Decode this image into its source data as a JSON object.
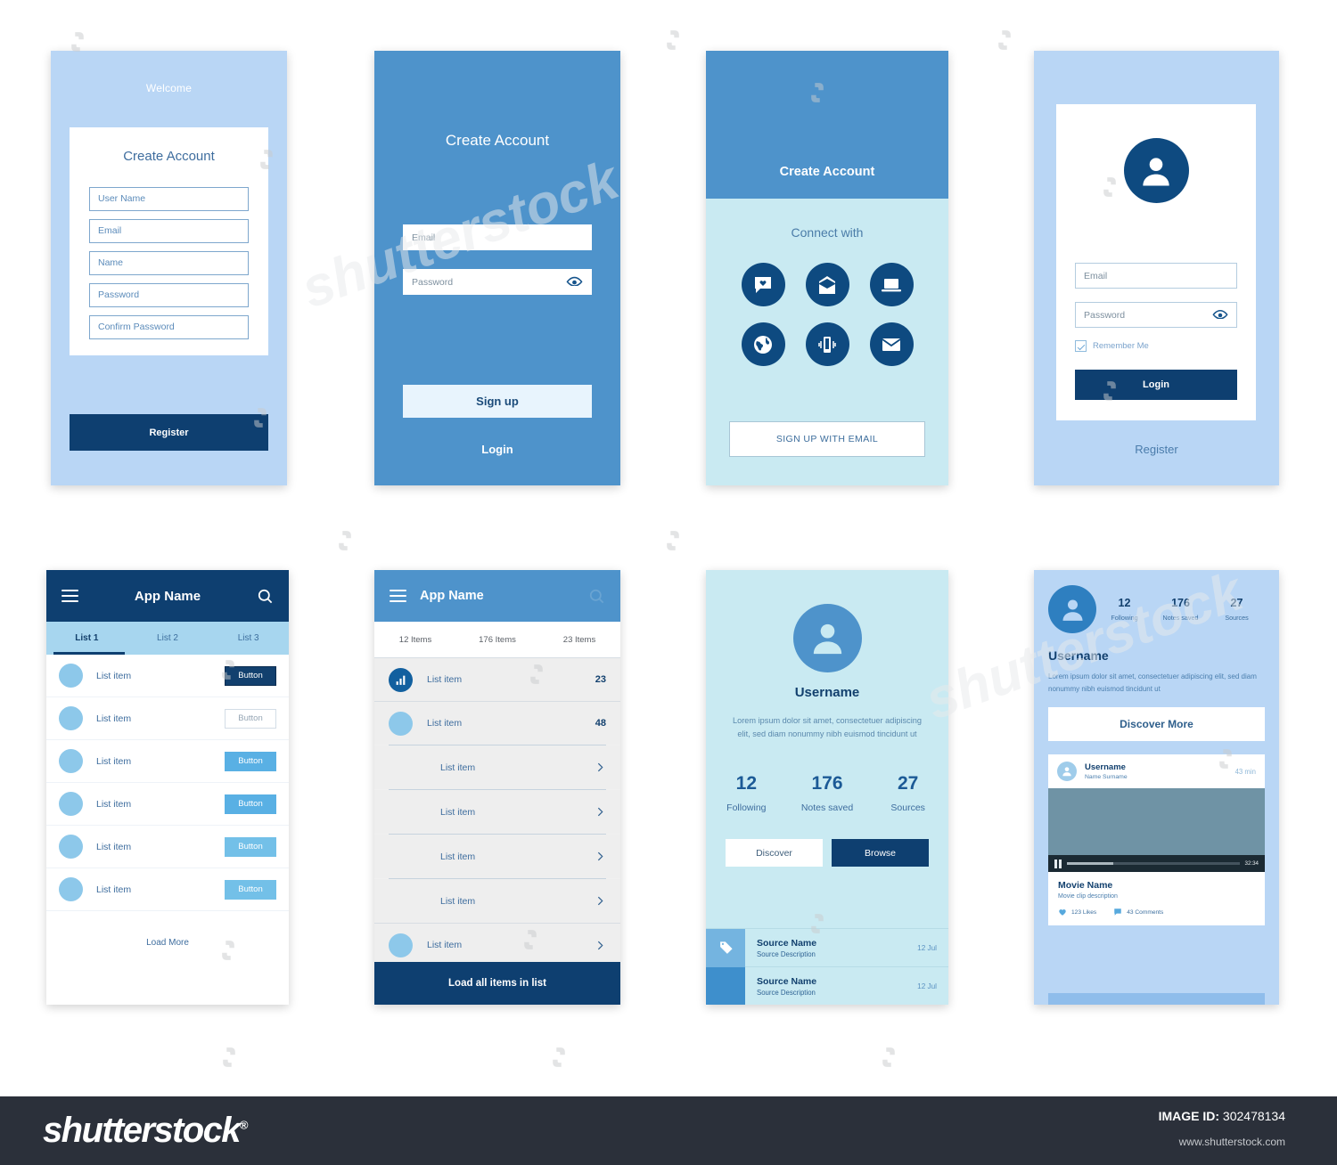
{
  "colors": {
    "navy": "#0e3f70",
    "blue": "#4e93cb",
    "light_blue": "#b9d6f5",
    "mint": "#c9eaf2",
    "accent": "#59b0e4"
  },
  "screen1": {
    "name": "create-account-form",
    "welcome": "Welcome",
    "title": "Create Account",
    "fields": [
      "User Name",
      "Email",
      "Name",
      "Password",
      "Confirm Password"
    ],
    "submit": "Register"
  },
  "screen2": {
    "name": "signup-blue",
    "title": "Create Account",
    "email": "Email",
    "password": "Password",
    "submit": "Sign up",
    "login_link": "Login"
  },
  "screen3": {
    "name": "connect-with-social",
    "title": "Create Account",
    "subtitle": "Connect with",
    "icons": [
      "chat-heart-icon",
      "open-envelope-icon",
      "laptop-icon",
      "globe-icon",
      "vibrating-phone-icon",
      "envelope-icon"
    ],
    "email_button": "SIGN UP WITH EMAIL"
  },
  "screen4": {
    "name": "login-card",
    "avatar": "user-avatar-icon",
    "email": "Email",
    "password": "Password",
    "remember": "Remember Me",
    "submit": "Login",
    "register_link": "Register"
  },
  "screen5": {
    "name": "list-with-buttons",
    "app_name": "App Name",
    "menu_icon": "hamburger-icon",
    "search_icon": "search-icon",
    "tabs": [
      "List 1",
      "List 2",
      "List 3"
    ],
    "active_tab": 0,
    "rows": [
      {
        "label": "List item",
        "button": "Button",
        "style": "dark"
      },
      {
        "label": "List item",
        "button": "Button",
        "style": "outline"
      },
      {
        "label": "List item",
        "button": "Button",
        "style": "blue"
      },
      {
        "label": "List item",
        "button": "Button",
        "style": "blue"
      },
      {
        "label": "List item",
        "button": "Button",
        "style": "blue"
      },
      {
        "label": "List item",
        "button": "Button",
        "style": "blue"
      }
    ],
    "load_more": "Load More"
  },
  "screen6": {
    "name": "list-with-counts",
    "app_name": "App Name",
    "menu_icon": "hamburger-icon",
    "search_icon": "search-icon",
    "tabs": [
      "12 Items",
      "176 Items",
      "23 Items"
    ],
    "rows": [
      {
        "label": "List item",
        "value": "23",
        "lead": "chart-icon"
      },
      {
        "label": "List item",
        "value": "48",
        "lead": "dot"
      },
      {
        "label": "List item",
        "value": "chevron",
        "lead": "none"
      },
      {
        "label": "List item",
        "value": "chevron",
        "lead": "none"
      },
      {
        "label": "List item",
        "value": "chevron",
        "lead": "none"
      },
      {
        "label": "List item",
        "value": "chevron",
        "lead": "none"
      },
      {
        "label": "List item",
        "value": "chevron",
        "lead": "dot"
      }
    ],
    "load_all": "Load all items in list"
  },
  "screen7": {
    "name": "profile-mint",
    "avatar": "user-avatar-icon",
    "username": "Username",
    "bio": "Lorem ipsum dolor sit amet, consectetuer adipiscing elit, sed diam nonummy nibh euismod tincidunt ut",
    "stats": [
      {
        "num": "12",
        "cap": "Following"
      },
      {
        "num": "176",
        "cap": "Notes saved"
      },
      {
        "num": "27",
        "cap": "Sources"
      }
    ],
    "actions": {
      "discover": "Discover",
      "browse": "Browse"
    },
    "sources": [
      {
        "name": "Source Name",
        "desc": "Source Description",
        "date": "12 Jul",
        "icon": "tag-icon"
      },
      {
        "name": "Source Name",
        "desc": "Source Description",
        "date": "12 Jul",
        "icon": "none"
      }
    ]
  },
  "screen8": {
    "name": "profile-feed",
    "avatar": "user-avatar-icon",
    "stats": [
      {
        "num": "12",
        "cap": "Following"
      },
      {
        "num": "176",
        "cap": "Notes saved"
      },
      {
        "num": "27",
        "cap": "Sources"
      }
    ],
    "username": "Username",
    "bio": "Lorem ipsum dolor sit amet, consectetuer adipiscing elit, sed diam nonummy nibh euismod tincidunt ut",
    "discover_more": "Discover More",
    "post": {
      "username": "Username",
      "fullname": "Name Surname",
      "time": "43 min",
      "video_time": "32:34",
      "title": "Movie Name",
      "description": "Movie clip description",
      "likes": "123 Likes",
      "comments": "43 Comments",
      "pause_icon": "pause-icon",
      "like_icon": "heart-icon",
      "comment_icon": "comment-icon"
    }
  },
  "footer": {
    "logo": "shutterstock",
    "image_id_label": "IMAGE ID:",
    "image_id": "302478134",
    "url": "www.shutterstock.com"
  }
}
